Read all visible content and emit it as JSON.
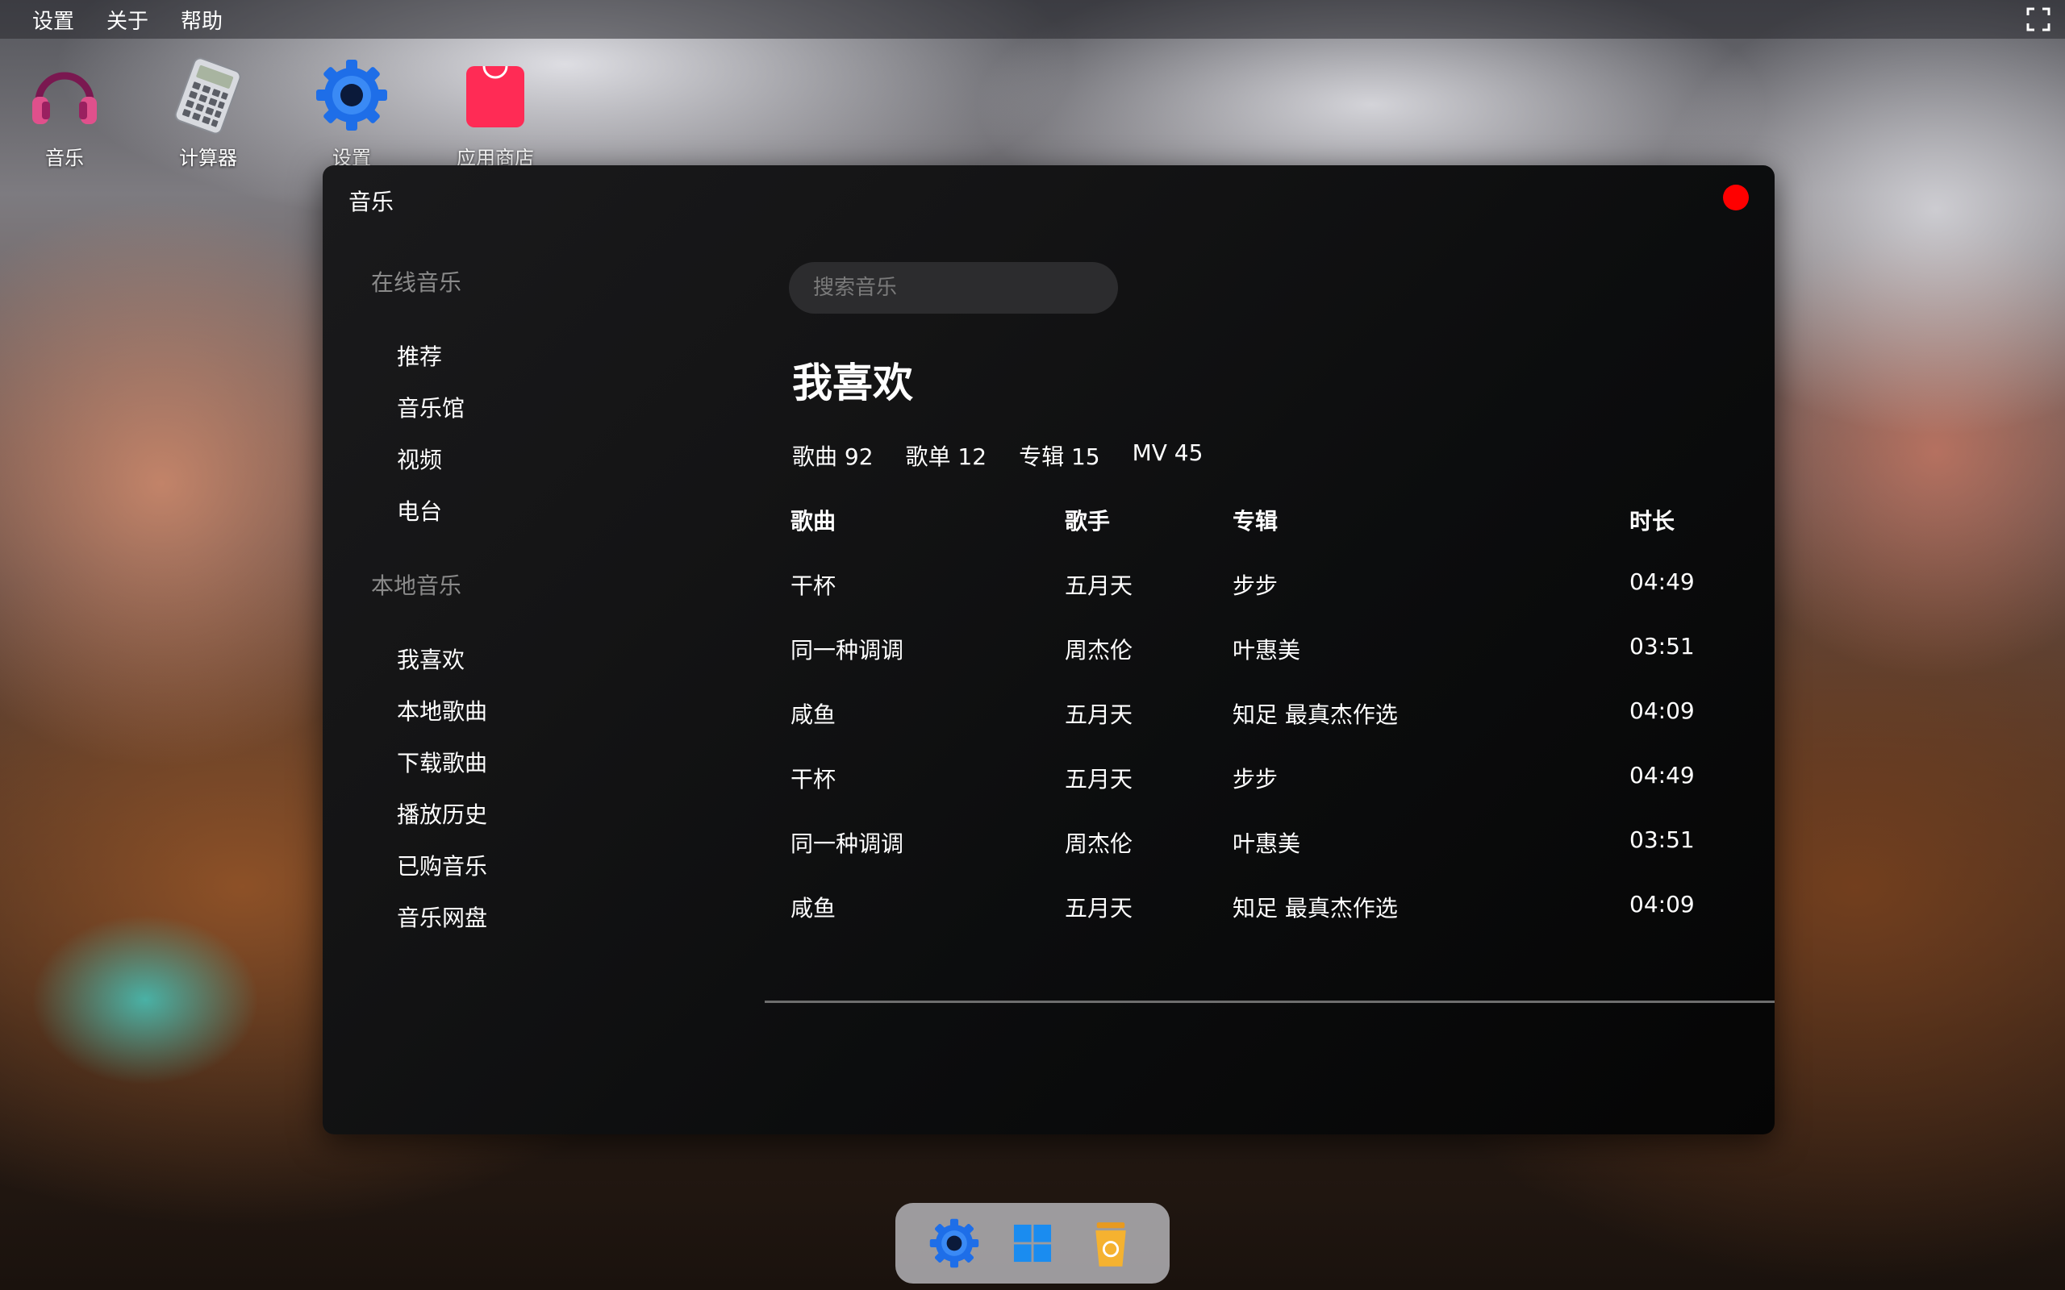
{
  "menubar": {
    "items": [
      "设置",
      "关于",
      "帮助"
    ]
  },
  "desktop": {
    "icons": [
      {
        "label": "音乐",
        "icon": "headphones-icon"
      },
      {
        "label": "计算器",
        "icon": "calculator-icon"
      },
      {
        "label": "设置",
        "icon": "gear-icon"
      },
      {
        "label": "应用商店",
        "icon": "shopping-bag-icon"
      }
    ]
  },
  "window": {
    "title": "音乐",
    "close_color": "#ff0000",
    "sidebar": {
      "online_section": "在线音乐",
      "online_items": [
        "推荐",
        "音乐馆",
        "视频",
        "电台"
      ],
      "local_section": "本地音乐",
      "local_items": [
        "我喜欢",
        "本地歌曲",
        "下载歌曲",
        "播放历史",
        "已购音乐",
        "音乐网盘"
      ]
    },
    "search": {
      "placeholder": "搜索音乐"
    },
    "page_title": "我喜欢",
    "stats": [
      "歌曲 92",
      "歌单 12",
      "专辑 15",
      "MV 45"
    ],
    "table": {
      "headers": {
        "song": "歌曲",
        "artist": "歌手",
        "album": "专辑",
        "duration": "时长"
      },
      "rows": [
        {
          "song": "干杯",
          "artist": "五月天",
          "album": "步步",
          "duration": "04:49"
        },
        {
          "song": "同一种调调",
          "artist": "周杰伦",
          "album": "叶惠美",
          "duration": "03:51"
        },
        {
          "song": "咸鱼",
          "artist": "五月天",
          "album": "知足 最真杰作选",
          "duration": "04:09"
        },
        {
          "song": "干杯",
          "artist": "五月天",
          "album": "步步",
          "duration": "04:49"
        },
        {
          "song": "同一种调调",
          "artist": "周杰伦",
          "album": "叶惠美",
          "duration": "03:51"
        },
        {
          "song": "咸鱼",
          "artist": "五月天",
          "album": "知足 最真杰作选",
          "duration": "04:09"
        }
      ]
    }
  },
  "dock": {
    "icons": [
      "gear-icon",
      "windows-logo-icon",
      "trash-bin-icon"
    ]
  }
}
